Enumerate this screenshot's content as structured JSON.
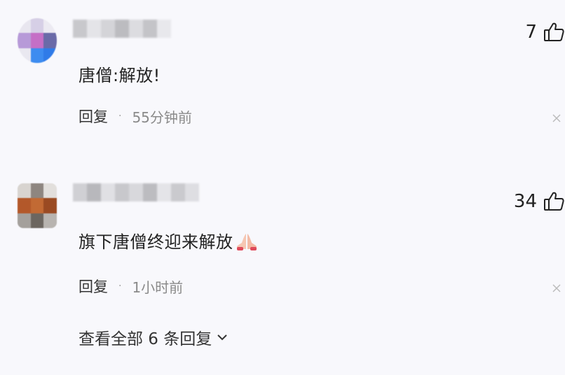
{
  "comments": [
    {
      "like_count": "7",
      "text": "唐僧:解放!",
      "reply_label": "回复",
      "separator": "·",
      "time": "55分钟前"
    },
    {
      "like_count": "34",
      "text": "旗下唐僧终迎来解放",
      "emoji": "praying-hands",
      "reply_label": "回复",
      "separator": "·",
      "time": "1小时前"
    }
  ],
  "view_more": "查看全部 6 条回复",
  "colors": {
    "background": "#f8f8fc",
    "text": "#222222",
    "meta_gray": "#8a8a8a"
  }
}
